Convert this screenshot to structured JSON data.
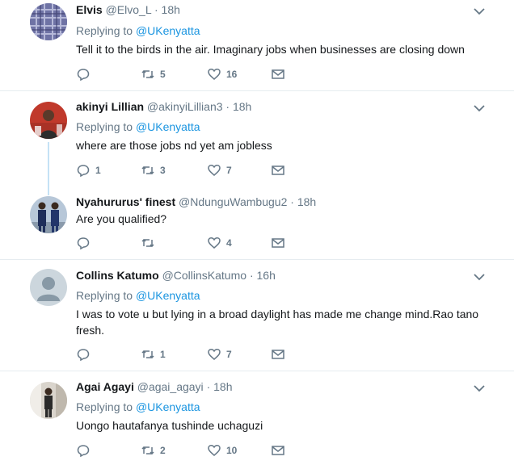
{
  "replying_label": "Replying to",
  "tweets": [
    {
      "name": "Elvis",
      "handle": "@Elvo_L",
      "time": "18h",
      "replying_to": "@UKenyatta",
      "text": "Tell it to the birds in the air. Imaginary jobs when businesses are closing down",
      "replies": "",
      "retweets": "5",
      "likes": "16",
      "avatar_icon": "plaid-shirt-photo"
    },
    {
      "name": "akinyi Lillian",
      "handle": "@akinyiLillian3",
      "time": "18h",
      "replying_to": "@UKenyatta",
      "text": "where are those jobs nd yet am jobless",
      "replies": "1",
      "retweets": "3",
      "likes": "7",
      "avatar_icon": "person-red-background-photo"
    },
    {
      "name": "Nyahururus' finest",
      "handle": "@NdunguWambugu2",
      "time": "18h",
      "replying_to": "",
      "text": "Are you qualified?",
      "replies": "",
      "retweets": "",
      "likes": "4",
      "avatar_icon": "two-men-suits-photo"
    },
    {
      "name": "Collins Katumo",
      "handle": "@CollinsKatumo",
      "time": "16h",
      "replying_to": "@UKenyatta",
      "text": "I was to vote u but  lying  in a broad daylight has made me change mind.Rao tano fresh.",
      "replies": "",
      "retweets": "1",
      "likes": "7",
      "avatar_icon": "default-user-silhouette"
    },
    {
      "name": "Agai Agayi",
      "handle": "@agai_agayi",
      "time": "18h",
      "replying_to": "@UKenyatta",
      "text": "Uongo hautafanya tushinde uchaguzi",
      "replies": "",
      "retweets": "2",
      "likes": "10",
      "avatar_icon": "man-standing-room-photo"
    }
  ],
  "colors": {
    "accent": "#1b95e0",
    "muted": "#657786",
    "divider": "#e6ecf0",
    "thread_line": "#c4e2f5"
  }
}
